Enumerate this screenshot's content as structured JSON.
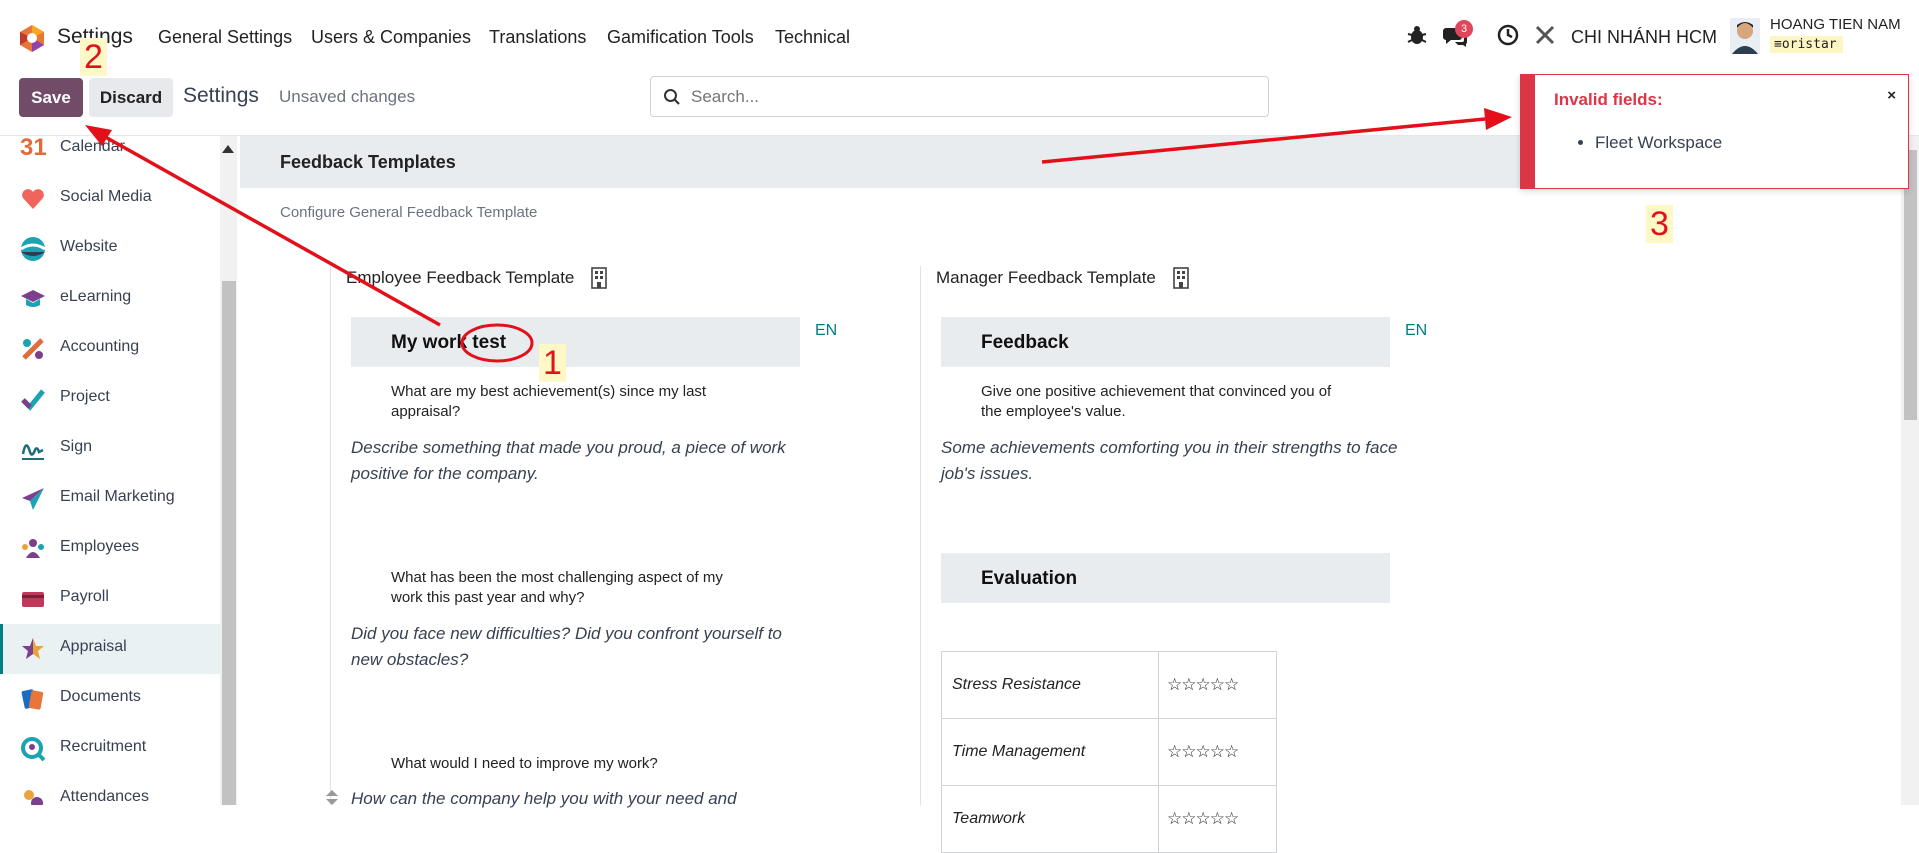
{
  "topbar": {
    "app_name": "Settings",
    "menu": [
      "General Settings",
      "Users & Companies",
      "Translations",
      "Gamification Tools",
      "Technical"
    ],
    "messages_badge": "3",
    "company": "CHI NHÁNH HCM",
    "user_name": "HOANG TIEN NAM",
    "database": "oristar"
  },
  "control_panel": {
    "save_label": "Save",
    "discard_label": "Discard",
    "title": "Settings",
    "status": "Unsaved changes",
    "search_placeholder": "Search..."
  },
  "sidebar": {
    "items": [
      {
        "label": "Calendar",
        "icon": "calendar-icon"
      },
      {
        "label": "Social Media",
        "icon": "social-media-icon"
      },
      {
        "label": "Website",
        "icon": "website-icon"
      },
      {
        "label": "eLearning",
        "icon": "elearning-icon"
      },
      {
        "label": "Accounting",
        "icon": "accounting-icon"
      },
      {
        "label": "Project",
        "icon": "project-icon"
      },
      {
        "label": "Sign",
        "icon": "sign-icon"
      },
      {
        "label": "Email Marketing",
        "icon": "email-marketing-icon"
      },
      {
        "label": "Employees",
        "icon": "employees-icon"
      },
      {
        "label": "Payroll",
        "icon": "payroll-icon"
      },
      {
        "label": "Appraisal",
        "icon": "appraisal-icon",
        "active": true
      },
      {
        "label": "Documents",
        "icon": "documents-icon"
      },
      {
        "label": "Recruitment",
        "icon": "recruitment-icon"
      },
      {
        "label": "Attendances",
        "icon": "attendances-icon"
      }
    ],
    "calendar_icon_text": "31"
  },
  "section": {
    "title": "Feedback Templates",
    "subtitle": "Configure General Feedback Template"
  },
  "employee_template": {
    "title": "Employee Feedback Template",
    "lang": "EN",
    "heading": "My work test",
    "qa": [
      {
        "q": "What are my best achievement(s) since my last appraisal?",
        "a": "Describe something that made you proud, a piece of work positive for the company."
      },
      {
        "q": "What has been the most challenging aspect of my work this past year and why?",
        "a": "Did you face new difficulties? Did you confront yourself to new obstacles?"
      },
      {
        "q": "What would I need to improve my work?",
        "a": "How can the company help you with your need and"
      }
    ]
  },
  "manager_template": {
    "title": "Manager Feedback Template",
    "lang": "EN",
    "heading": "Feedback",
    "qa": [
      {
        "q": "Give one positive achievement that convinced you of the employee's value.",
        "a": "Some achievements comforting you in their strengths to face job's issues."
      }
    ],
    "evaluation_heading": "Evaluation",
    "evaluation_rows": [
      {
        "name": "Stress Resistance",
        "stars": "☆☆☆☆☆"
      },
      {
        "name": "Time Management",
        "stars": "☆☆☆☆☆"
      },
      {
        "name": "Teamwork",
        "stars": "☆☆☆☆☆"
      }
    ]
  },
  "toast": {
    "title": "Invalid fields:",
    "close": "×",
    "items": [
      "Fleet Workspace"
    ]
  },
  "annotations": {
    "one": "1",
    "two": "2",
    "three": "3"
  },
  "colors": {
    "brand": "#714b67",
    "accent": "#017e84",
    "danger": "#dc3545",
    "annotation": "#e3101a"
  }
}
